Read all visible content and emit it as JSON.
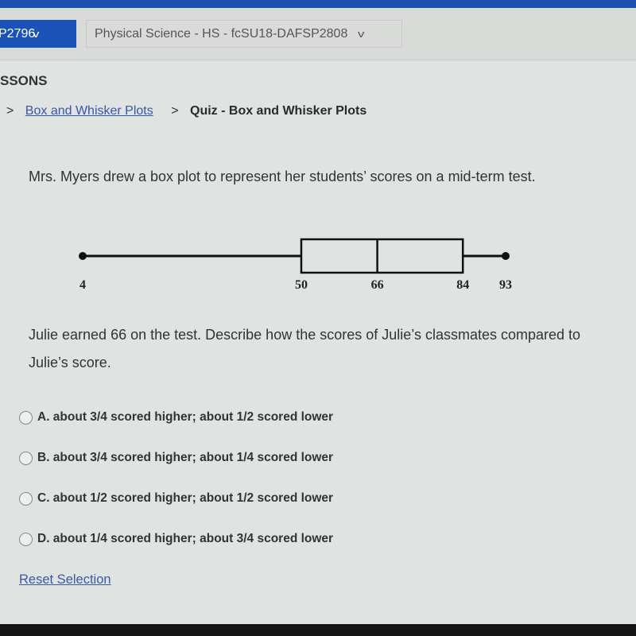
{
  "nav": {
    "course_code": "P2796",
    "course_select": "Physical Science - HS - fcSU18-DAFSP2808"
  },
  "section_title": "SSONS",
  "breadcrumb": {
    "sep": ">",
    "parent": "Box and Whisker Plots",
    "current": "Quiz - Box and Whisker Plots"
  },
  "question": {
    "intro": "Mrs. Myers drew a box plot to represent her students’ scores on a mid-term test.",
    "prompt": "Julie earned 66 on the test. Describe how the scores of Julie’s classmates compared to Julie’s score."
  },
  "chart_data": {
    "type": "box",
    "min": 4,
    "q1": 50,
    "median": 66,
    "q3": 84,
    "max": 93,
    "tick_labels": [
      "4",
      "50",
      "66",
      "84",
      "93"
    ]
  },
  "options": [
    {
      "label": "A. about 3/4 scored higher; about 1/2 scored lower",
      "selected": false
    },
    {
      "label": "B. about 3/4 scored higher; about 1/4 scored lower",
      "selected": false
    },
    {
      "label": "C. about 1/2 scored higher; about 1/2 scored lower",
      "selected": false
    },
    {
      "label": "D. about 1/4 scored higher; about 3/4 scored lower",
      "selected": false
    }
  ],
  "reset_label": "Reset Selection",
  "colors": {
    "brand": "#1b52b8",
    "link": "#3c55a5"
  }
}
